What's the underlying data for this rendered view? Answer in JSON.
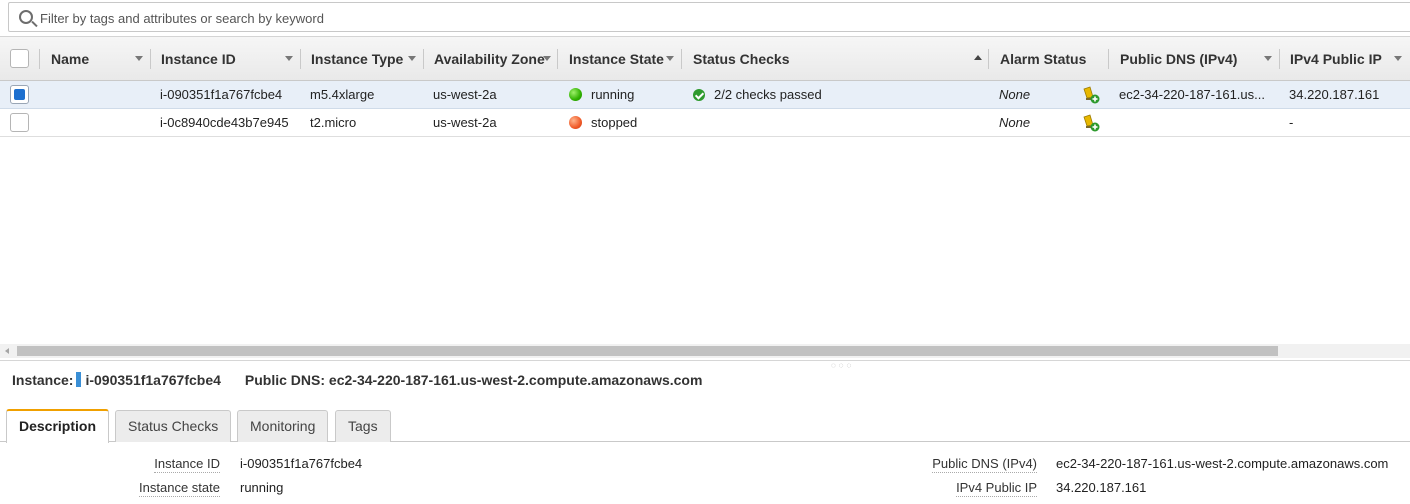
{
  "search": {
    "placeholder": "Filter by tags and attributes or search by keyword",
    "value": ""
  },
  "table": {
    "columns": [
      "Name",
      "Instance ID",
      "Instance Type",
      "Availability Zone",
      "Instance State",
      "Status Checks",
      "Alarm Status",
      "Public DNS (IPv4)",
      "IPv4 Public IP"
    ],
    "sorted_column": "Status Checks",
    "rows": [
      {
        "selected": true,
        "name": "",
        "instance_id": "i-090351f1a767fcbe4",
        "instance_type": "m5.4xlarge",
        "availability_zone": "us-west-2a",
        "instance_state": "running",
        "state_color": "#2fb000",
        "status_checks": "2/2 checks passed",
        "alarm_status": "None",
        "public_dns": "ec2-34-220-187-161.us...",
        "public_ip": "34.220.187.161"
      },
      {
        "selected": false,
        "name": "",
        "instance_id": "i-0c8940cde43b7e945",
        "instance_type": "t2.micro",
        "availability_zone": "us-west-2a",
        "instance_state": "stopped",
        "state_color": "#f05a28",
        "status_checks": "",
        "alarm_status": "None",
        "public_dns": "",
        "public_ip": "-"
      }
    ]
  },
  "details": {
    "instance_label": "Instance:",
    "instance_id": "i-090351f1a767fcbe4",
    "public_dns_label": "Public DNS:",
    "public_dns": "ec2-34-220-187-161.us-west-2.compute.amazonaws.com",
    "tabs": [
      "Description",
      "Status Checks",
      "Monitoring",
      "Tags"
    ],
    "active_tab": "Description",
    "fields_left": [
      {
        "label": "Instance ID",
        "value": "i-090351f1a767fcbe4"
      },
      {
        "label": "Instance state",
        "value": "running"
      }
    ],
    "fields_right": [
      {
        "label": "Public DNS (IPv4)",
        "value": "ec2-34-220-187-161.us-west-2.compute.amazonaws.com"
      },
      {
        "label": "IPv4 Public IP",
        "value": "34.220.187.161"
      }
    ]
  },
  "colors": {
    "selected_row": "#e8eff8",
    "checkbox_checked": "#1c6fcf",
    "tab_accent": "#f0a000",
    "instance_flag": "#3a8fd6"
  },
  "icons": {
    "search": "search-icon",
    "running": "green-status-dot-icon",
    "stopped": "red-status-dot-icon",
    "checks_passed": "check-circle-icon",
    "alarm": "create-alarm-icon"
  }
}
